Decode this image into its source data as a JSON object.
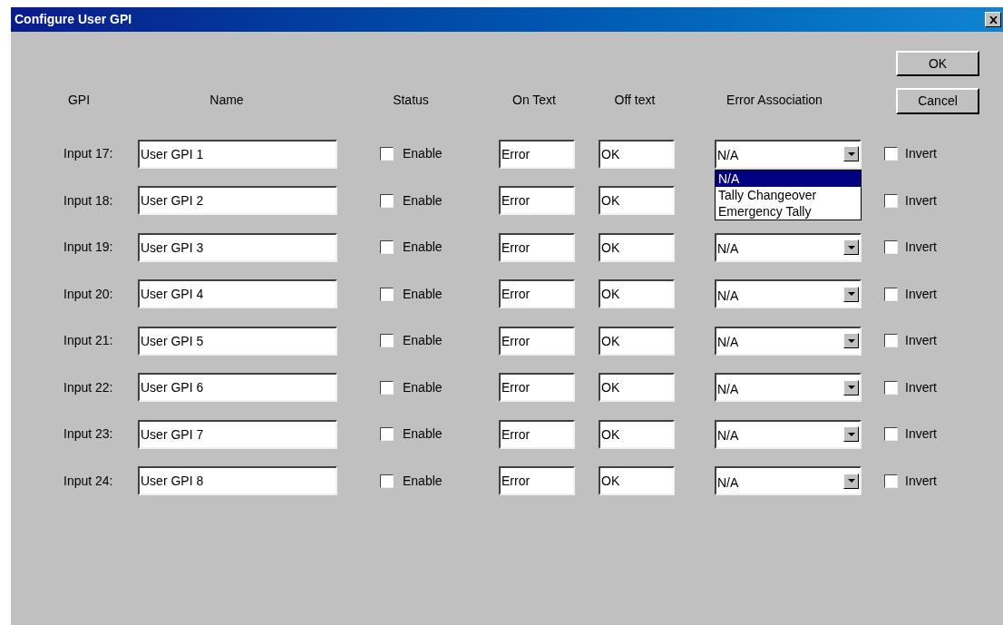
{
  "window": {
    "title": "Configure User GPI"
  },
  "buttons": [
    "OK",
    "Cancel"
  ],
  "columns": [
    "GPI",
    "Name",
    "Status",
    "On Text",
    "Off text",
    "Error Association"
  ],
  "rows": [
    {
      "label": "Input 17:",
      "name": "User GPI 1",
      "status_label": "Enable",
      "enabled": false,
      "on_text": "Error",
      "off_text": "OK",
      "association": "N/A",
      "invert_label": "Invert",
      "invert": false,
      "dropdown": [
        {
          "label": "N/A",
          "selected": true
        },
        {
          "label": "Tally Changeover",
          "selected": false
        },
        {
          "label": "Emergency Tally",
          "selected": false
        }
      ]
    },
    {
      "label": "Input 18:",
      "name": "User GPI 2",
      "status_label": "Enable",
      "enabled": false,
      "on_text": "Error",
      "off_text": "OK",
      "invert_label": "Invert",
      "invert": false
    },
    {
      "label": "Input 19:",
      "name": "User GPI 3",
      "status_label": "Enable",
      "enabled": false,
      "on_text": "Error",
      "off_text": "OK",
      "association": "N/A",
      "invert_label": "Invert",
      "invert": false
    },
    {
      "label": "Input 20:",
      "name": "User GPI 4",
      "status_label": "Enable",
      "enabled": false,
      "on_text": "Error",
      "off_text": "OK",
      "association": "N/A",
      "invert_label": "Invert",
      "invert": false
    },
    {
      "label": "Input 21:",
      "name": "User GPI 5",
      "status_label": "Enable",
      "enabled": false,
      "on_text": "Error",
      "off_text": "OK",
      "association": "N/A",
      "invert_label": "Invert",
      "invert": false
    },
    {
      "label": "Input 22:",
      "name": "User GPI 6",
      "status_label": "Enable",
      "enabled": false,
      "on_text": "Error",
      "off_text": "OK",
      "association": "N/A",
      "invert_label": "Invert",
      "invert": false
    },
    {
      "label": "Input 23:",
      "name": "User GPI 7",
      "status_label": "Enable",
      "enabled": false,
      "on_text": "Error",
      "off_text": "OK",
      "association": "N/A",
      "invert_label": "Invert",
      "invert": false
    },
    {
      "label": "Input 24:",
      "name": "User GPI 8",
      "status_label": "Enable",
      "enabled": false,
      "on_text": "Error",
      "off_text": "OK",
      "association": "N/A",
      "invert_label": "Invert",
      "invert": false
    }
  ]
}
